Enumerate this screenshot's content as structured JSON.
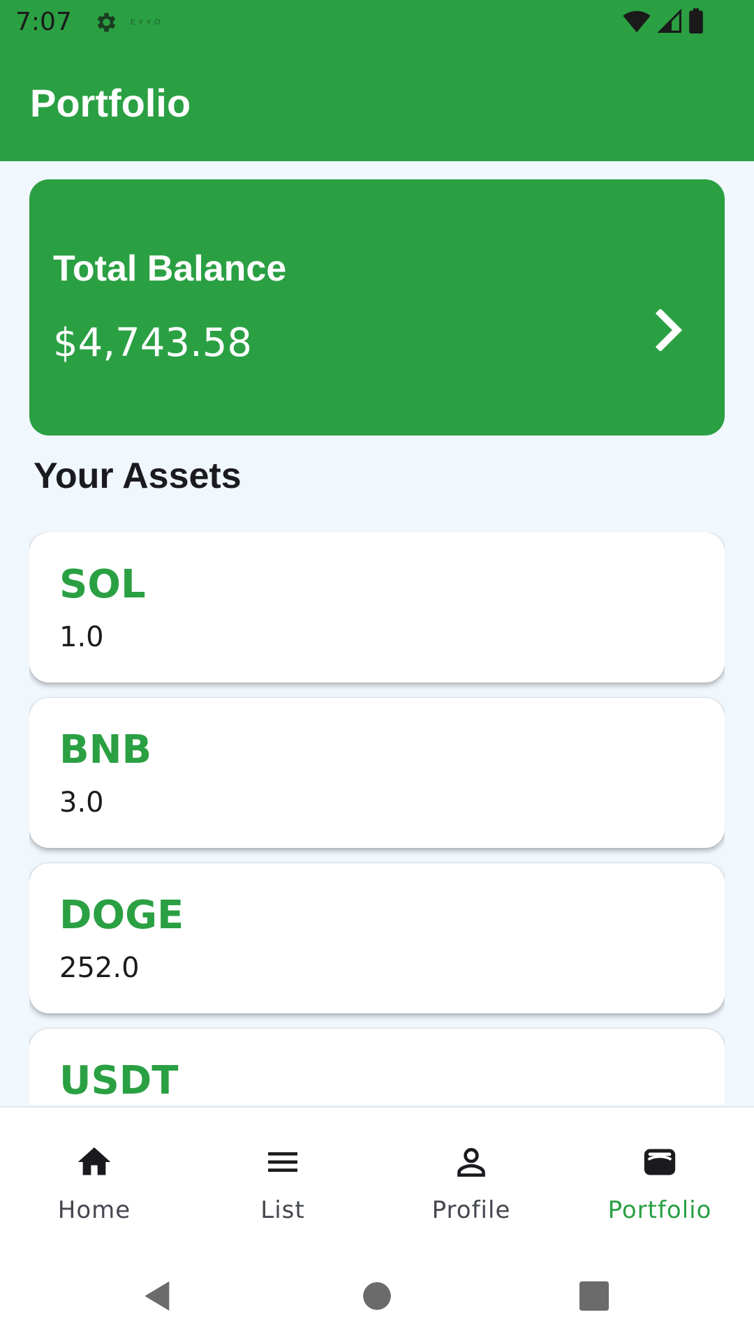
{
  "status_bar": {
    "time": "7:07",
    "tag": "EYYO",
    "icons": [
      "gear-icon",
      "wifi-icon",
      "signal-icon",
      "battery-icon"
    ]
  },
  "app_bar": {
    "title": "Portfolio"
  },
  "balance": {
    "label": "Total Balance",
    "value": "$4,743.58",
    "icon": "chevron-right-icon"
  },
  "assets_section": {
    "title": "Your Assets"
  },
  "assets": [
    {
      "symbol": "SOL",
      "amount": "1.0"
    },
    {
      "symbol": "BNB",
      "amount": "3.0"
    },
    {
      "symbol": "DOGE",
      "amount": "252.0"
    },
    {
      "symbol": "USDT",
      "amount": ""
    }
  ],
  "bottom_nav": {
    "items": [
      {
        "label": "Home",
        "icon": "home-icon",
        "active": false
      },
      {
        "label": "List",
        "icon": "list-icon",
        "active": false
      },
      {
        "label": "Profile",
        "icon": "profile-icon",
        "active": false
      },
      {
        "label": "Portfolio",
        "icon": "wallet-icon",
        "active": true
      }
    ]
  },
  "colors": {
    "primary": "#2aa043",
    "background": "#f0f7fd",
    "text": "#1b1b1f"
  }
}
